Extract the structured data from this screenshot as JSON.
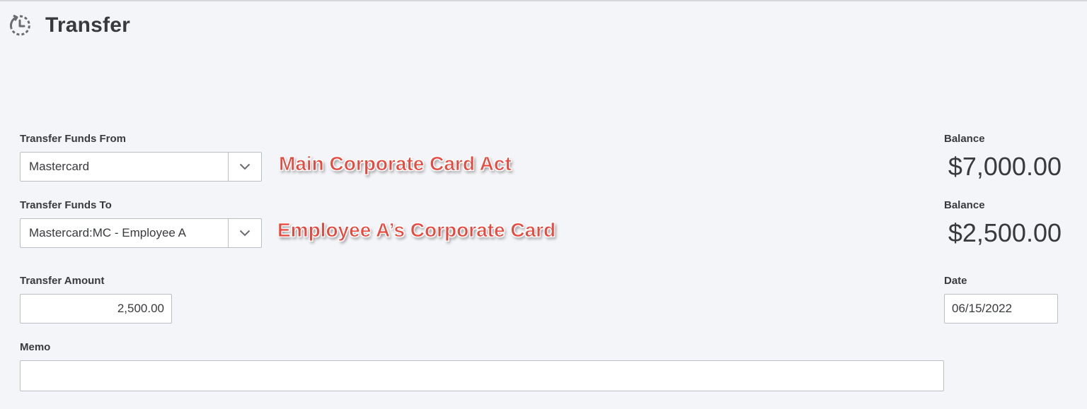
{
  "page": {
    "title": "Transfer",
    "icon": "transfer-clock-icon"
  },
  "from": {
    "label": "Transfer Funds From",
    "value": "Mastercard",
    "annotation": "Main Corporate Card Act",
    "balance_label": "Balance",
    "balance": "$7,000.00"
  },
  "to": {
    "label": "Transfer Funds To",
    "value": "Mastercard:MC - Employee A",
    "annotation": "Employee A’s Corporate Card",
    "balance_label": "Balance",
    "balance": "$2,500.00"
  },
  "amount": {
    "label": "Transfer Amount",
    "value": "2,500.00"
  },
  "date": {
    "label": "Date",
    "value": "06/15/2022"
  },
  "memo": {
    "label": "Memo",
    "value": ""
  },
  "colors": {
    "background": "#f4f5f8",
    "annotation": "#e8483e",
    "border": "#babec5",
    "text": "#393a3d"
  }
}
